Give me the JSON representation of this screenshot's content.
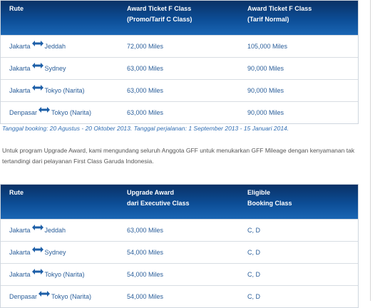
{
  "table1": {
    "headers": [
      "Rute",
      "Award Ticket F Class",
      "(Promo/Tarif C Class)",
      "Award Ticket F Class",
      "(Tarif Normal)"
    ],
    "rows": [
      {
        "from": "Jakarta",
        "to": "Jeddah",
        "c1": "72,000 Miles",
        "c2": "105,000 Miles"
      },
      {
        "from": "Jakarta",
        "to": "Sydney",
        "c1": "63,000 Miles",
        "c2": "90,000 Miles"
      },
      {
        "from": "Jakarta",
        "to": "Tokyo (Narita)",
        "c1": "63,000 Miles",
        "c2": "90,000 Miles"
      },
      {
        "from": "Denpasar",
        "to": "Tokyo (Narita)",
        "c1": "63,000 Miles",
        "c2": "90,000 Miles"
      }
    ]
  },
  "note": "Tanggal booking: 20 Agustus - 20 Oktober 2013. Tanggal perjalanan: 1 September 2013 - 15 Januari 2014.",
  "paragraph": "Untuk program Upgrade Award, kami mengundang seluruh Anggota GFF untuk menukarkan GFF Mileage dengan kenyamanan tak tertandingi dari pelayanan First Class Garuda Indonesia.",
  "table2": {
    "headers": [
      "Rute",
      "Upgrade Award",
      "dari Executive Class",
      "Eligible",
      "Booking Class"
    ],
    "rows": [
      {
        "from": "Jakarta",
        "to": "Jeddah",
        "c1": "63,000 Miles",
        "c2": "C, D"
      },
      {
        "from": "Jakarta",
        "to": "Sydney",
        "c1": "54,000 Miles",
        "c2": "C, D"
      },
      {
        "from": "Jakarta",
        "to": "Tokyo (Narita)",
        "c1": "54,000 Miles",
        "c2": "C, D"
      },
      {
        "from": "Denpasar",
        "to": "Tokyo (Narita)",
        "c1": "54,000 Miles",
        "c2": "C, D"
      }
    ]
  },
  "colors": {
    "header_top": "#0a3166",
    "header_bottom": "#1a66b4",
    "text": "#2a5e9a",
    "note": "#2f6db3",
    "arrow": "#1d5fa8"
  },
  "icons": {
    "route_arrow": "double-arrow-icon"
  }
}
